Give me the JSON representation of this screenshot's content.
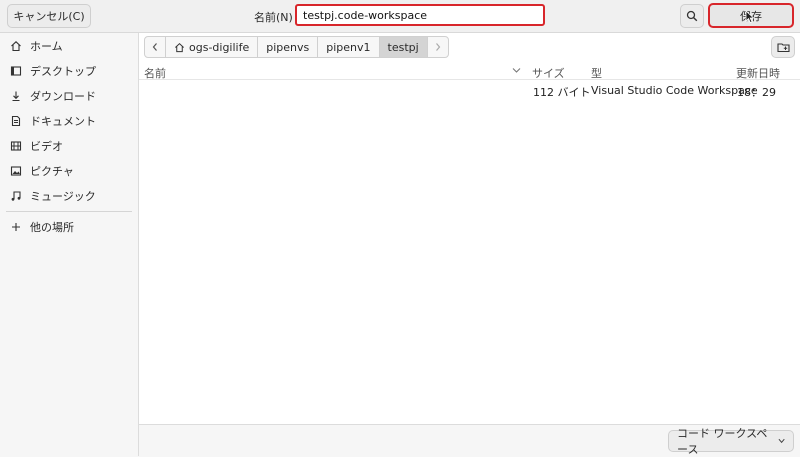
{
  "header": {
    "cancel_label": "キャンセル(C)",
    "name_label": "名前(N)",
    "filename_value": "testpj.code-workspace",
    "save_label": "保存"
  },
  "sidebar": {
    "items": [
      {
        "label": "ホーム",
        "icon": "home-icon"
      },
      {
        "label": "デスクトップ",
        "icon": "desktop-icon"
      },
      {
        "label": "ダウンロード",
        "icon": "download-icon"
      },
      {
        "label": "ドキュメント",
        "icon": "document-icon"
      },
      {
        "label": "ビデオ",
        "icon": "video-icon"
      },
      {
        "label": "ピクチャ",
        "icon": "picture-icon"
      },
      {
        "label": "ミュージック",
        "icon": "music-icon"
      }
    ],
    "other_locations": "他の場所"
  },
  "path": {
    "crumbs": [
      "ogs-digilife",
      "pipenvs",
      "pipenv1",
      "testpj"
    ]
  },
  "table": {
    "columns": [
      "名前",
      "サイズ",
      "型",
      "更新日時"
    ],
    "rows": [
      {
        "name": "",
        "size": "112 バイト",
        "type": "Visual Studio Code Workspace",
        "modified": "18：29"
      }
    ]
  },
  "footer": {
    "filter_value": "コード ワークスペース"
  },
  "colors": {
    "highlight": "#d8262b",
    "active_crumb": "#d4d4d4"
  }
}
